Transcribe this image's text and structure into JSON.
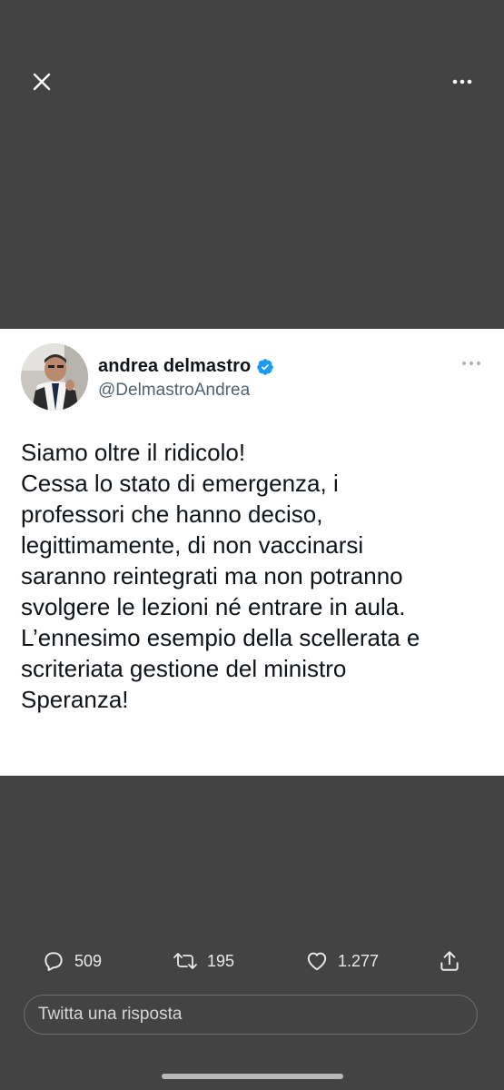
{
  "topbar": {
    "close_icon": "close-icon",
    "more_icon": "more-horizontal-icon"
  },
  "tweet": {
    "display_name": "andrea delmastro",
    "verified": true,
    "handle": "@DelmastroAndrea",
    "text_lines": [
      "Siamo oltre il ridicolo!",
      "Cessa lo stato di emergenza, i",
      "professori che hanno deciso,",
      "legittimamente, di non vaccinarsi",
      "saranno reintegrati ma non potranno",
      "svolgere le lezioni né entrare in aula.",
      "L’ennesimo esempio della scellerata e",
      "scriteriata gestione del ministro",
      "Speranza!"
    ]
  },
  "actions": {
    "reply_count": "509",
    "retweet_count": "195",
    "like_count": "1.277"
  },
  "reply": {
    "placeholder": "Twitta una risposta"
  },
  "colors": {
    "background": "#434343",
    "card": "#ffffff",
    "verified_blue": "#1d9bf0",
    "text": "#0f1419",
    "handle": "#536471"
  }
}
